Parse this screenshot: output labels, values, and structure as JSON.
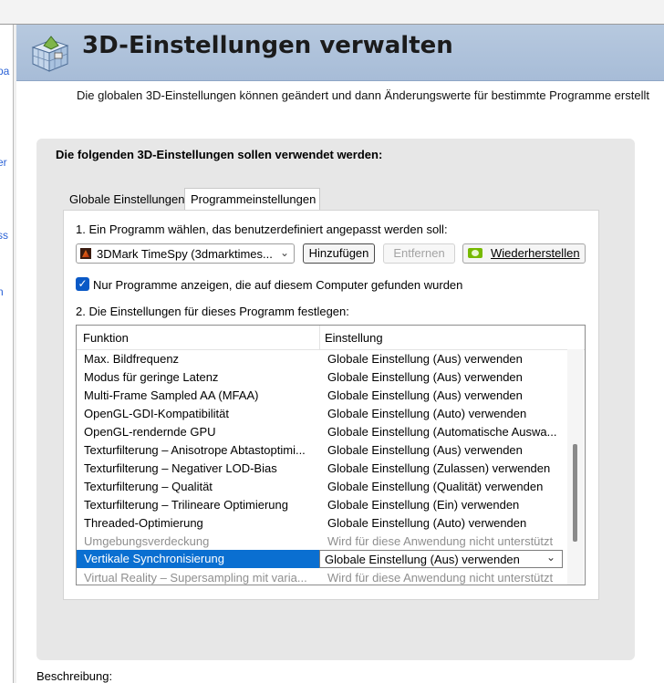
{
  "left_panel": {
    "fragments": [
      "pa",
      "er",
      "ss",
      "n"
    ]
  },
  "header": {
    "title": "3D-Einstellungen verwalten",
    "logo_icon": "3d-cube-grid-icon",
    "subtitle": "Die globalen 3D-Einstellungen können geändert und dann Änderungswerte für bestimmte Programme erstellt"
  },
  "panel": {
    "title": "Die folgenden 3D-Einstellungen sollen verwendet werden:",
    "tabs": [
      {
        "label": "Globale Einstellungen",
        "active": false
      },
      {
        "label": "Programmeinstellungen",
        "active": true
      }
    ],
    "step1_label": "1. Ein Programm wählen, das benutzerdefiniert angepasst werden soll:",
    "program_select": {
      "value": "3DMark TimeSpy (3dmarktimes...",
      "icon": "3dmark-app-icon"
    },
    "buttons": {
      "add": "Hinzufügen",
      "remove": "Entfernen",
      "restore": "Wiederherstellen"
    },
    "checkbox": {
      "checked": true,
      "label": "Nur Programme anzeigen, die auf diesem Computer gefunden wurden"
    },
    "step2_label": "2. Die Einstellungen für dieses Programm festlegen:",
    "table": {
      "headers": [
        "Funktion",
        "Einstellung"
      ],
      "rows": [
        {
          "function": "Max. Bildfrequenz",
          "setting": "Globale Einstellung (Aus) verwenden"
        },
        {
          "function": "Modus für geringe Latenz",
          "setting": "Globale Einstellung (Aus) verwenden"
        },
        {
          "function": "Multi-Frame Sampled AA (MFAA)",
          "setting": "Globale Einstellung (Aus) verwenden"
        },
        {
          "function": "OpenGL-GDI-Kompatibilität",
          "setting": "Globale Einstellung (Auto) verwenden"
        },
        {
          "function": "OpenGL-rendernde GPU",
          "setting": "Globale Einstellung (Automatische Auswa..."
        },
        {
          "function": "Texturfilterung – Anisotrope Abtastoptimi...",
          "setting": "Globale Einstellung (Aus) verwenden"
        },
        {
          "function": "Texturfilterung – Negativer LOD-Bias",
          "setting": "Globale Einstellung (Zulassen) verwenden"
        },
        {
          "function": "Texturfilterung – Qualität",
          "setting": "Globale Einstellung (Qualität) verwenden"
        },
        {
          "function": "Texturfilterung – Trilineare Optimierung",
          "setting": "Globale Einstellung (Ein) verwenden"
        },
        {
          "function": "Threaded-Optimierung",
          "setting": "Globale Einstellung (Auto) verwenden"
        },
        {
          "function": "Umgebungsverdeckung",
          "setting": "Wird für diese Anwendung nicht unterstützt"
        },
        {
          "function": "Vertikale Synchronisierung",
          "setting": "Globale Einstellung (Aus) verwenden"
        },
        {
          "function": "Virtual Reality – Supersampling mit varia...",
          "setting": "Wird für diese Anwendung nicht unterstützt"
        }
      ]
    }
  },
  "description_label": "Beschreibung:"
}
